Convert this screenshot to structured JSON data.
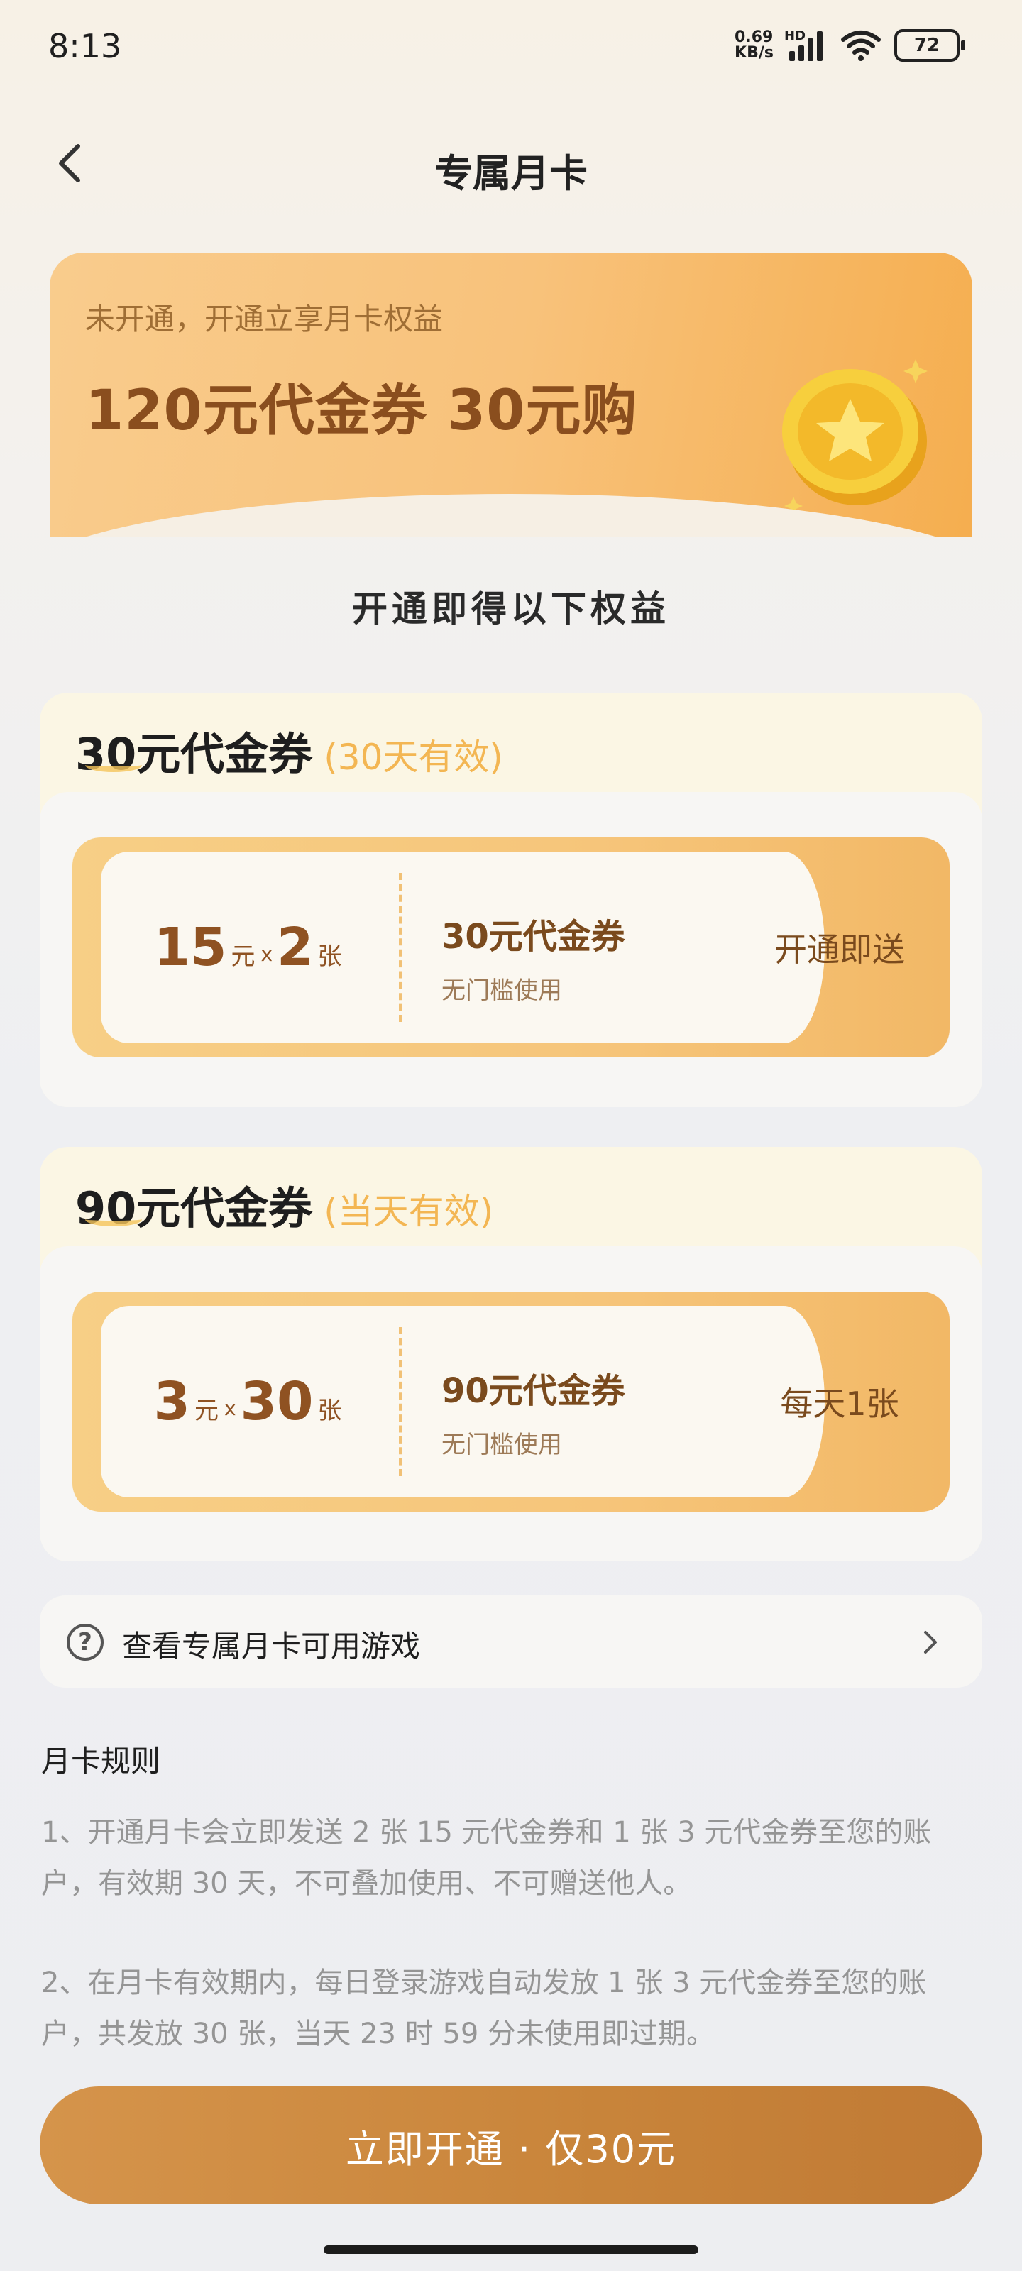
{
  "status_bar": {
    "time": "8:13",
    "net_speed_value": "0.69",
    "net_speed_unit": "KB/s",
    "hd_label": "HD",
    "battery": "72"
  },
  "nav": {
    "title": "专属月卡"
  },
  "hero": {
    "subtitle": "未开通，开通立享月卡权益",
    "title": "120元代金券 30元购"
  },
  "benefits_heading": "开通即得以下权益",
  "sections": [
    {
      "title": "30元代金券",
      "validity": "(30天有效)",
      "ticket": {
        "amount_value": "15",
        "amount_unit": "元",
        "times": "x",
        "count_value": "2",
        "count_unit": "张",
        "name": "30元代金券",
        "desc": "无门槛使用",
        "action": "开通即送"
      }
    },
    {
      "title": "90元代金券",
      "validity": "(当天有效)",
      "ticket": {
        "amount_value": "3",
        "amount_unit": "元",
        "times": "x",
        "count_value": "30",
        "count_unit": "张",
        "name": "90元代金券",
        "desc": "无门槛使用",
        "action": "每天1张"
      }
    }
  ],
  "games_link": {
    "label": "查看专属月卡可用游戏"
  },
  "rules": {
    "title": "月卡规则",
    "items": [
      "1、开通月卡会立即发送 2 张 15 元代金券和 1 张 3 元代金券至您的账户，有效期 30 天，不可叠加使用、不可赠送他人。",
      "2、在月卡有效期内，每日登录游戏自动发放 1 张 3 元代金券至您的账户，共发放 30 张，当天 23 时 59 分未使用即过期。"
    ]
  },
  "cta": {
    "label": "立即开通 · 仅30元"
  },
  "colors": {
    "accent": "#c8843a",
    "hero_title": "#8a4e1e",
    "validity": "#f3b653"
  }
}
